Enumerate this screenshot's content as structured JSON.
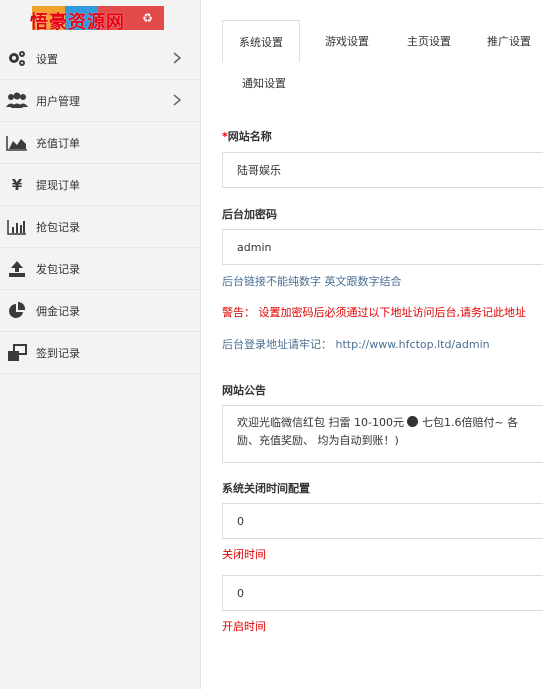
{
  "logo": {
    "text": "悟豪资源网",
    "tile_colors": [
      "#f0a22b",
      "#3399dd",
      "#e34a4a",
      "#e34a4a"
    ]
  },
  "sidebar": {
    "items": [
      {
        "label": "设置",
        "icon": "gears-icon",
        "has_chevron": true
      },
      {
        "label": "用户管理",
        "icon": "users-icon",
        "has_chevron": true
      },
      {
        "label": "充值订单",
        "icon": "area-chart-icon",
        "has_chevron": false
      },
      {
        "label": "提现订单",
        "icon": "yen-icon",
        "has_chevron": false
      },
      {
        "label": "抢包记录",
        "icon": "bar-chart-icon",
        "has_chevron": false
      },
      {
        "label": "发包记录",
        "icon": "upload-icon",
        "has_chevron": false
      },
      {
        "label": "佣金记录",
        "icon": "pie-chart-icon",
        "has_chevron": false
      },
      {
        "label": "签到记录",
        "icon": "windows-icon",
        "has_chevron": false
      }
    ]
  },
  "tabs": [
    {
      "label": "系统设置",
      "active": true
    },
    {
      "label": "游戏设置",
      "active": false
    },
    {
      "label": "主页设置",
      "active": false
    },
    {
      "label": "推广设置",
      "active": false
    },
    {
      "label": "通知设置",
      "active": false
    }
  ],
  "form": {
    "site_name_label": "网站名称",
    "site_name_required": "*",
    "site_name_value": "陆哥娱乐",
    "admin_password_label": "后台加密码",
    "admin_password_value": "admin",
    "password_hint": "后台链接不能纯数字 英文跟数字结合",
    "warning": "警告： 设置加密码后必须通过以下地址访问后台,请务记此地址",
    "admin_url_text": "后台登录地址请牢记： http://www.hfctop.ltd/admin",
    "announcement_label": "网站公告",
    "announcement_line1": "欢迎光临微信红包 扫雷  10-100元",
    "announcement_line1_after": " 七包1.6倍赔付~ 各",
    "announcement_line2": "励、充值奖励、 均为自动到账！)",
    "close_config_label": "系统关闭时间配置",
    "close_time_value": "0",
    "close_time_label": "关闭时间",
    "open_time_value": "0",
    "open_time_label": "开启时间"
  },
  "colors": {
    "accent_red": "#e00000",
    "link_blue": "#4a6f93",
    "sidebar_bg": "#f3f3f3"
  }
}
